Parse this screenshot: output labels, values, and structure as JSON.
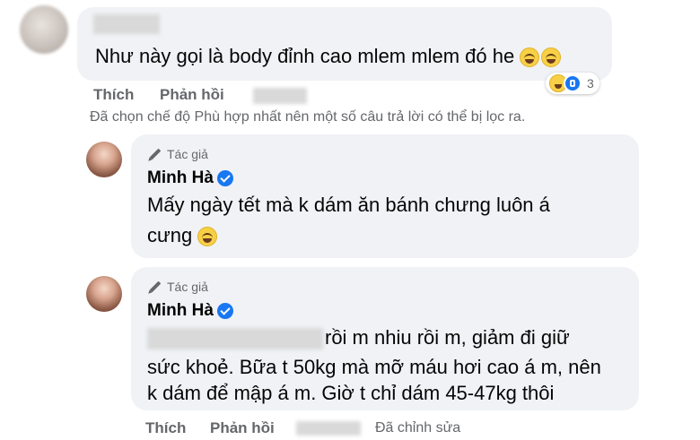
{
  "comment1": {
    "text": "Như này gọi là body đỉnh cao mlem mlem đó he",
    "reaction_count": "3",
    "like_label": "Thích",
    "reply_label": "Phản hồi"
  },
  "filter_note": "Đã chọn chế độ Phù hợp nhất nên một số câu trả lời có thể bị lọc ra.",
  "reply1": {
    "author_badge": "Tác giả",
    "author_name": "Minh Hà",
    "text_line1": "Mấy ngày tết mà k dám ăn bánh chưng luôn á",
    "text_line2": "cưng"
  },
  "reply2": {
    "author_badge": "Tác giả",
    "author_name": "Minh Hà",
    "text_line1": "rồi m nhiu rồi m, giảm đi giữ",
    "text_line2": "sức khoẻ. Bữa t 50kg mà mỡ máu hơi cao á m, nên",
    "text_line3": "k dám để mập á m. Giờ t chỉ dám 45-47kg thôi",
    "like_label": "Thích",
    "reply_label": "Phản hồi",
    "edited_label": "Đã chỉnh sửa"
  },
  "icons": {
    "pencil": "pencil-icon",
    "verified": "verified-badge-icon",
    "emoji": "laughing-emoji-icon",
    "haha": "haha-reaction-icon",
    "like": "like-reaction-icon"
  }
}
